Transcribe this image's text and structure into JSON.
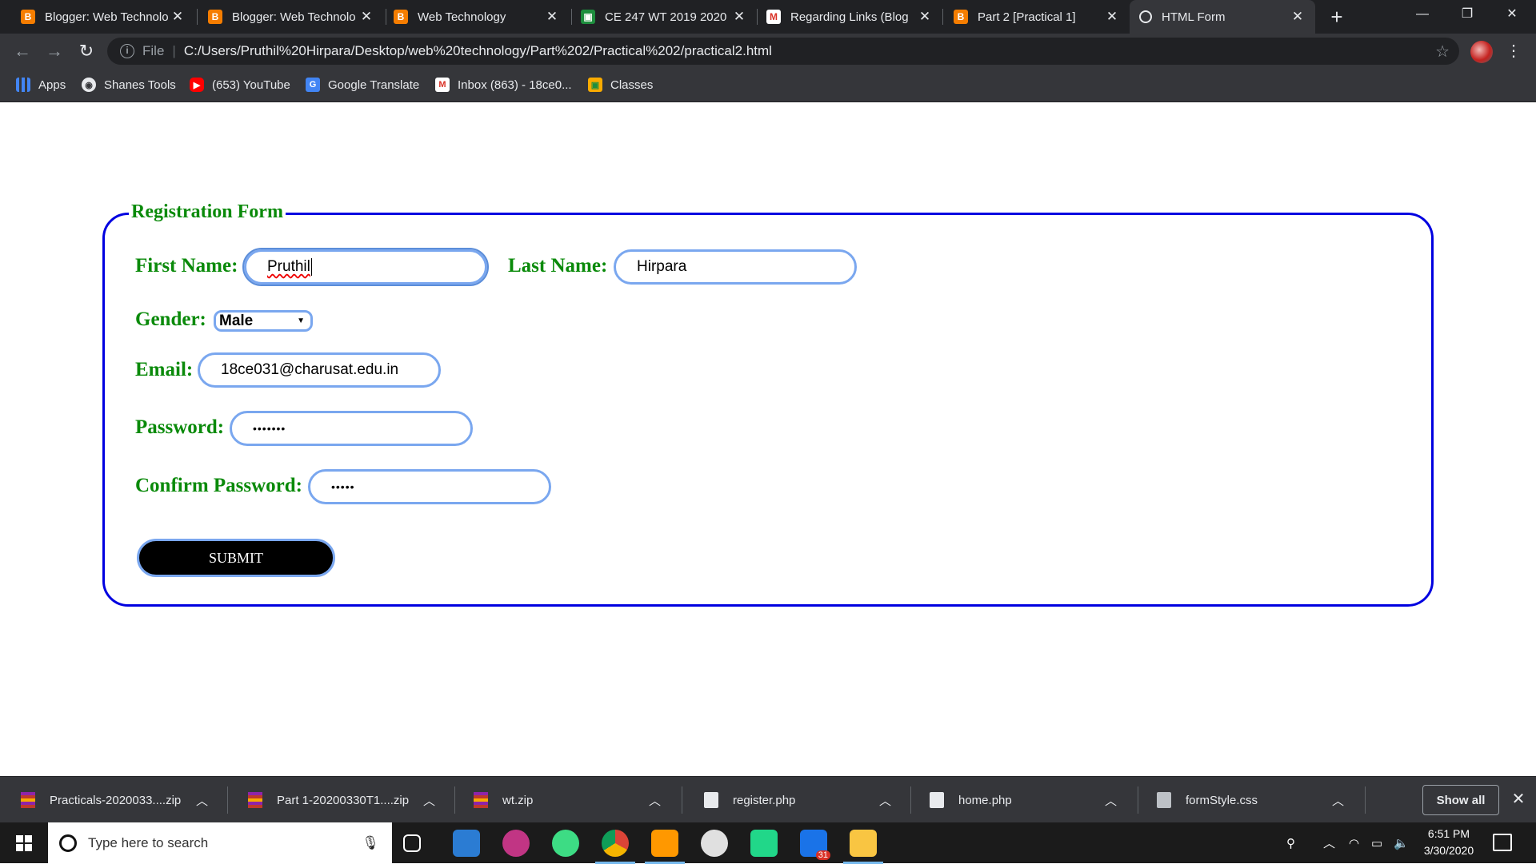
{
  "browser": {
    "tabs": [
      {
        "title": "Blogger: Web Technolo",
        "icon": "blogger-icon",
        "active": false
      },
      {
        "title": "Blogger: Web Technolo",
        "icon": "blogger-icon",
        "active": false
      },
      {
        "title": "Web Technology",
        "icon": "blogger-icon",
        "active": false
      },
      {
        "title": "CE 247 WT 2019 2020",
        "icon": "classroom-icon",
        "active": false
      },
      {
        "title": "Regarding Links (Blog",
        "icon": "gmail-icon",
        "active": false
      },
      {
        "title": "Part 2 [Practical 1]",
        "icon": "blogger-icon",
        "active": false
      },
      {
        "title": "HTML Form",
        "icon": "globe-icon",
        "active": true
      }
    ],
    "address": {
      "scheme": "File",
      "url": "C:/Users/Pruthil%20Hirpara/Desktop/web%20technology/Part%202/Practical%202/practical2.html"
    },
    "bookmarks": [
      {
        "label": "Apps",
        "icon": "apps-grid-icon"
      },
      {
        "label": "Shanes Tools",
        "icon": "shanes-tools-icon"
      },
      {
        "label": "(653) YouTube",
        "icon": "youtube-icon"
      },
      {
        "label": "Google Translate",
        "icon": "google-translate-icon"
      },
      {
        "label": "Inbox (863) - 18ce0...",
        "icon": "gmail-icon"
      },
      {
        "label": "Classes",
        "icon": "classroom-icon"
      }
    ]
  },
  "form": {
    "legend": "Registration Form",
    "first_name": {
      "label": "First Name:",
      "value": "Pruthil"
    },
    "last_name": {
      "label": "Last Name:",
      "value": "Hirpara"
    },
    "gender": {
      "label": "Gender:",
      "selected": "Male"
    },
    "email": {
      "label": "Email:",
      "value": "18ce031@charusat.edu.in"
    },
    "password": {
      "label": "Password:",
      "masked": "•••••••"
    },
    "confirm_password": {
      "label": "Confirm Password:",
      "masked": "•••••"
    },
    "submit_label": "SUBMIT",
    "colors": {
      "label": "#0a8a0a",
      "fieldset_border": "#0000e0",
      "input_border": "#7aa7ef",
      "button_bg": "#000000"
    }
  },
  "downloads": {
    "items": [
      {
        "name": "Practicals-2020033....zip",
        "icon": "zip-archive-icon"
      },
      {
        "name": "Part 1-20200330T1....zip",
        "icon": "zip-archive-icon"
      },
      {
        "name": "wt.zip",
        "icon": "zip-archive-icon"
      },
      {
        "name": "register.php",
        "icon": "file-icon"
      },
      {
        "name": "home.php",
        "icon": "file-icon"
      },
      {
        "name": "formStyle.css",
        "icon": "css-file-icon"
      }
    ],
    "show_all": "Show all"
  },
  "taskbar": {
    "search_placeholder": "Type here to search",
    "clock_time": "6:51 PM",
    "clock_date": "3/30/2020",
    "calendar_badge": "31"
  }
}
